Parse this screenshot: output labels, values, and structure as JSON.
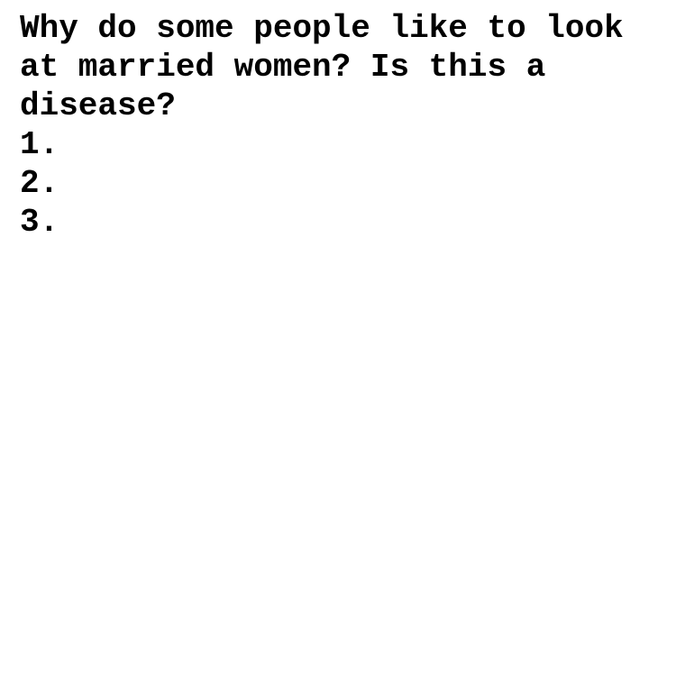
{
  "document": {
    "question": "Why do some people like to look at married women? Is this a disease?",
    "items": [
      "1.",
      "2.",
      "3."
    ]
  }
}
